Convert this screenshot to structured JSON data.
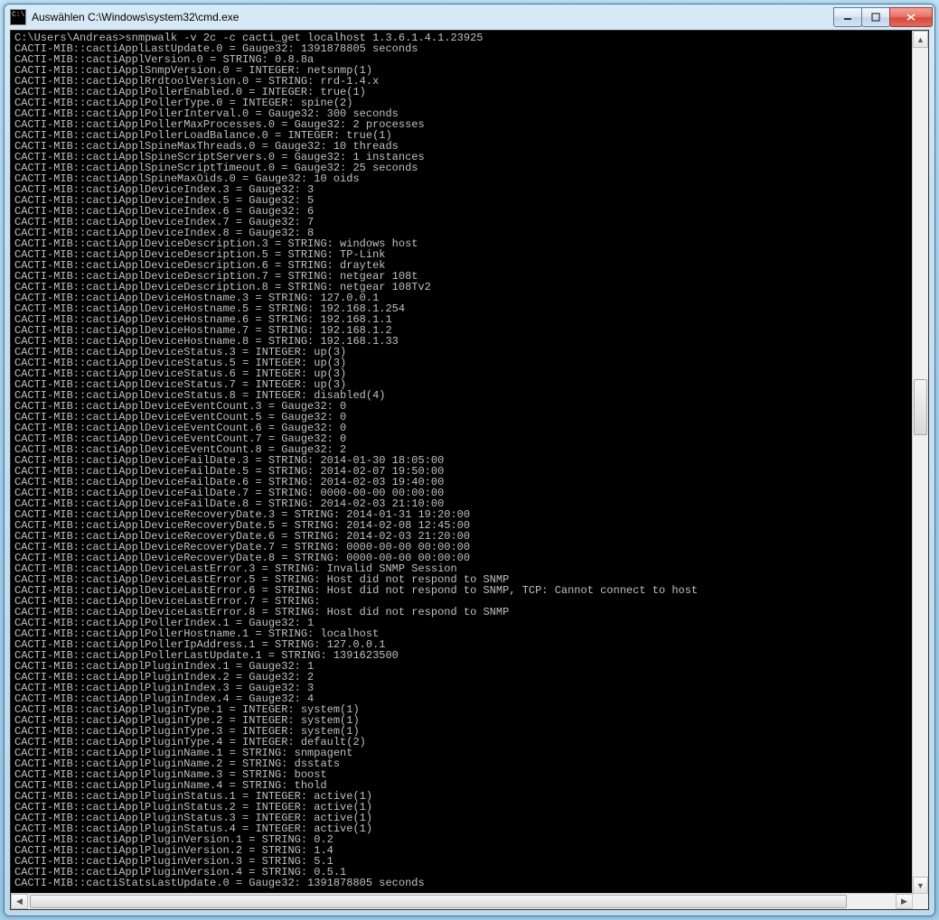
{
  "window": {
    "title": "Auswählen C:\\Windows\\system32\\cmd.exe"
  },
  "console": {
    "prompt": "C:\\Users\\Andreas>",
    "command": "snmpwalk -v 2c -c cacti_get localhost 1.3.6.1.4.1.23925",
    "lines": [
      "CACTI-MIB::cactiApplLastUpdate.0 = Gauge32: 1391878805 seconds",
      "CACTI-MIB::cactiApplVersion.0 = STRING: 0.8.8a",
      "CACTI-MIB::cactiApplSnmpVersion.0 = INTEGER: netsnmp(1)",
      "CACTI-MIB::cactiApplRrdtoolVersion.0 = STRING: rrd-1.4.x",
      "CACTI-MIB::cactiApplPollerEnabled.0 = INTEGER: true(1)",
      "CACTI-MIB::cactiApplPollerType.0 = INTEGER: spine(2)",
      "CACTI-MIB::cactiApplPollerInterval.0 = Gauge32: 300 seconds",
      "CACTI-MIB::cactiApplPollerMaxProcesses.0 = Gauge32: 2 processes",
      "CACTI-MIB::cactiApplPollerLoadBalance.0 = INTEGER: true(1)",
      "CACTI-MIB::cactiApplSpineMaxThreads.0 = Gauge32: 10 threads",
      "CACTI-MIB::cactiApplSpineScriptServers.0 = Gauge32: 1 instances",
      "CACTI-MIB::cactiApplSpineScriptTimeout.0 = Gauge32: 25 seconds",
      "CACTI-MIB::cactiApplSpineMaxOids.0 = Gauge32: 10 oids",
      "CACTI-MIB::cactiApplDeviceIndex.3 = Gauge32: 3",
      "CACTI-MIB::cactiApplDeviceIndex.5 = Gauge32: 5",
      "CACTI-MIB::cactiApplDeviceIndex.6 = Gauge32: 6",
      "CACTI-MIB::cactiApplDeviceIndex.7 = Gauge32: 7",
      "CACTI-MIB::cactiApplDeviceIndex.8 = Gauge32: 8",
      "CACTI-MIB::cactiApplDeviceDescription.3 = STRING: windows host",
      "CACTI-MIB::cactiApplDeviceDescription.5 = STRING: TP-Link",
      "CACTI-MIB::cactiApplDeviceDescription.6 = STRING: draytek",
      "CACTI-MIB::cactiApplDeviceDescription.7 = STRING: netgear 108t",
      "CACTI-MIB::cactiApplDeviceDescription.8 = STRING: netgear 108Tv2",
      "CACTI-MIB::cactiApplDeviceHostname.3 = STRING: 127.0.0.1",
      "CACTI-MIB::cactiApplDeviceHostname.5 = STRING: 192.168.1.254",
      "CACTI-MIB::cactiApplDeviceHostname.6 = STRING: 192.168.1.1",
      "CACTI-MIB::cactiApplDeviceHostname.7 = STRING: 192.168.1.2",
      "CACTI-MIB::cactiApplDeviceHostname.8 = STRING: 192.168.1.33",
      "CACTI-MIB::cactiApplDeviceStatus.3 = INTEGER: up(3)",
      "CACTI-MIB::cactiApplDeviceStatus.5 = INTEGER: up(3)",
      "CACTI-MIB::cactiApplDeviceStatus.6 = INTEGER: up(3)",
      "CACTI-MIB::cactiApplDeviceStatus.7 = INTEGER: up(3)",
      "CACTI-MIB::cactiApplDeviceStatus.8 = INTEGER: disabled(4)",
      "CACTI-MIB::cactiApplDeviceEventCount.3 = Gauge32: 0",
      "CACTI-MIB::cactiApplDeviceEventCount.5 = Gauge32: 0",
      "CACTI-MIB::cactiApplDeviceEventCount.6 = Gauge32: 0",
      "CACTI-MIB::cactiApplDeviceEventCount.7 = Gauge32: 0",
      "CACTI-MIB::cactiApplDeviceEventCount.8 = Gauge32: 2",
      "CACTI-MIB::cactiApplDeviceFailDate.3 = STRING: 2014-01-30 18:05:00",
      "CACTI-MIB::cactiApplDeviceFailDate.5 = STRING: 2014-02-07 19:50:00",
      "CACTI-MIB::cactiApplDeviceFailDate.6 = STRING: 2014-02-03 19:40:00",
      "CACTI-MIB::cactiApplDeviceFailDate.7 = STRING: 0000-00-00 00:00:00",
      "CACTI-MIB::cactiApplDeviceFailDate.8 = STRING: 2014-02-03 21:10:00",
      "CACTI-MIB::cactiApplDeviceRecoveryDate.3 = STRING: 2014-01-31 19:20:00",
      "CACTI-MIB::cactiApplDeviceRecoveryDate.5 = STRING: 2014-02-08 12:45:00",
      "CACTI-MIB::cactiApplDeviceRecoveryDate.6 = STRING: 2014-02-03 21:20:00",
      "CACTI-MIB::cactiApplDeviceRecoveryDate.7 = STRING: 0000-00-00 00:00:00",
      "CACTI-MIB::cactiApplDeviceRecoveryDate.8 = STRING: 0000-00-00 00:00:00",
      "CACTI-MIB::cactiApplDeviceLastError.3 = STRING: Invalid SNMP Session",
      "CACTI-MIB::cactiApplDeviceLastError.5 = STRING: Host did not respond to SNMP",
      "CACTI-MIB::cactiApplDeviceLastError.6 = STRING: Host did not respond to SNMP, TCP: Cannot connect to host",
      "CACTI-MIB::cactiApplDeviceLastError.7 = STRING:",
      "CACTI-MIB::cactiApplDeviceLastError.8 = STRING: Host did not respond to SNMP",
      "CACTI-MIB::cactiApplPollerIndex.1 = Gauge32: 1",
      "CACTI-MIB::cactiApplPollerHostname.1 = STRING: localhost",
      "CACTI-MIB::cactiApplPollerIpAddress.1 = STRING: 127.0.0.1",
      "CACTI-MIB::cactiApplPollerLastUpdate.1 = STRING: 1391623500",
      "CACTI-MIB::cactiApplPluginIndex.1 = Gauge32: 1",
      "CACTI-MIB::cactiApplPluginIndex.2 = Gauge32: 2",
      "CACTI-MIB::cactiApplPluginIndex.3 = Gauge32: 3",
      "CACTI-MIB::cactiApplPluginIndex.4 = Gauge32: 4",
      "CACTI-MIB::cactiApplPluginType.1 = INTEGER: system(1)",
      "CACTI-MIB::cactiApplPluginType.2 = INTEGER: system(1)",
      "CACTI-MIB::cactiApplPluginType.3 = INTEGER: system(1)",
      "CACTI-MIB::cactiApplPluginType.4 = INTEGER: default(2)",
      "CACTI-MIB::cactiApplPluginName.1 = STRING: snmpagent",
      "CACTI-MIB::cactiApplPluginName.2 = STRING: dsstats",
      "CACTI-MIB::cactiApplPluginName.3 = STRING: boost",
      "CACTI-MIB::cactiApplPluginName.4 = STRING: thold",
      "CACTI-MIB::cactiApplPluginStatus.1 = INTEGER: active(1)",
      "CACTI-MIB::cactiApplPluginStatus.2 = INTEGER: active(1)",
      "CACTI-MIB::cactiApplPluginStatus.3 = INTEGER: active(1)",
      "CACTI-MIB::cactiApplPluginStatus.4 = INTEGER: active(1)",
      "CACTI-MIB::cactiApplPluginVersion.1 = STRING: 0.2",
      "CACTI-MIB::cactiApplPluginVersion.2 = STRING: 1.4",
      "CACTI-MIB::cactiApplPluginVersion.3 = STRING: 5.1",
      "CACTI-MIB::cactiApplPluginVersion.4 = STRING: 0.5.1",
      "CACTI-MIB::cactiStatsLastUpdate.0 = Gauge32: 1391878805 seconds"
    ]
  }
}
